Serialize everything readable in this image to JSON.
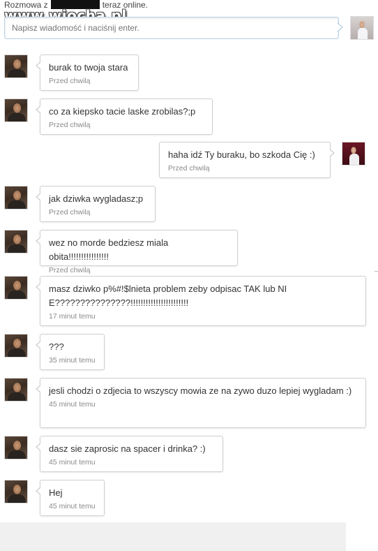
{
  "header": {
    "prefix": "Rozmowa z",
    "suffix": "teraz online."
  },
  "watermark": "www.wiocha.pl",
  "compose": {
    "placeholder": "Napisz wiadomość i naciśnij enter."
  },
  "messages": [
    {
      "side": "left",
      "text": "burak to twoja stara",
      "time": "Przed chwilą"
    },
    {
      "side": "left",
      "text": "co za kiepsko tacie laske zrobilas?;p",
      "time": "Przed chwilą"
    },
    {
      "side": "right",
      "text": "haha idź Ty buraku, bo szkoda Cię :)",
      "time": "Przed chwilą"
    },
    {
      "side": "left",
      "text": "jak dziwka wygladasz;p",
      "time": "Przed chwilą"
    },
    {
      "side": "left",
      "text": "wez no morde bedziesz miala obita!!!!!!!!!!!!!!!!",
      "time": "Przed chwilą"
    },
    {
      "side": "left",
      "text": "masz dziwko p%#!$lnieta problem zeby odpisac TAK lub NIE???????????????!!!!!!!!!!!!!!!!!!!!!!!",
      "time": "17 minut temu"
    },
    {
      "side": "left",
      "text": "???",
      "time": "35 minut temu"
    },
    {
      "side": "left",
      "text": "jesli chodzi o zdjecia to wszyscy mowia ze na zywo duzo lepiej wygladam :)",
      "time": "45 minut temu"
    },
    {
      "side": "left",
      "text": "dasz sie zaprosic na spacer i drinka? :)",
      "time": "45 minut temu"
    },
    {
      "side": "left",
      "text": "Hej",
      "time": "45 minut temu"
    }
  ]
}
